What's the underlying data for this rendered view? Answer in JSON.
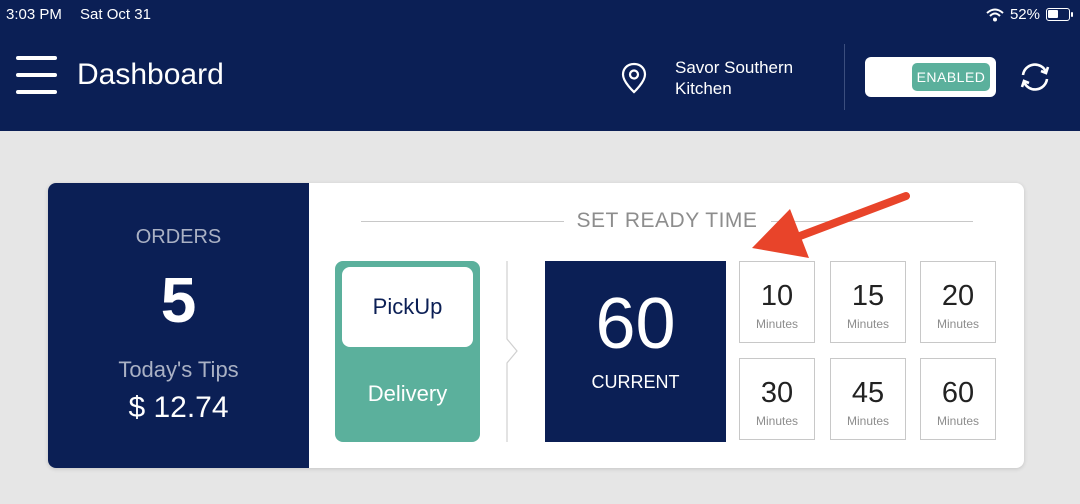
{
  "status_bar": {
    "time": "3:03 PM",
    "date": "Sat Oct 31",
    "battery": "52%"
  },
  "header": {
    "title": "Dashboard",
    "restaurant": "Savor Southern Kitchen",
    "toggle_label": "ENABLED",
    "menu_icon": "hamburger-icon",
    "location_icon": "location-pin-icon",
    "refresh_icon": "refresh-icon"
  },
  "orders": {
    "label": "ORDERS",
    "count": "5",
    "tips_label": "Today's Tips",
    "tips_value": "$ 12.74"
  },
  "ready_time": {
    "heading": "SET READY TIME",
    "modes": {
      "pickup": "PickUp",
      "delivery": "Delivery"
    },
    "current_value": "60",
    "current_label": "CURRENT",
    "options": [
      {
        "value": "10",
        "unit": "Minutes"
      },
      {
        "value": "15",
        "unit": "Minutes"
      },
      {
        "value": "20",
        "unit": "Minutes"
      },
      {
        "value": "30",
        "unit": "Minutes"
      },
      {
        "value": "45",
        "unit": "Minutes"
      },
      {
        "value": "60",
        "unit": "Minutes"
      }
    ]
  },
  "colors": {
    "navy": "#0b1f55",
    "accent_green": "#5bb09c",
    "annotation_arrow": "#e8442a"
  }
}
